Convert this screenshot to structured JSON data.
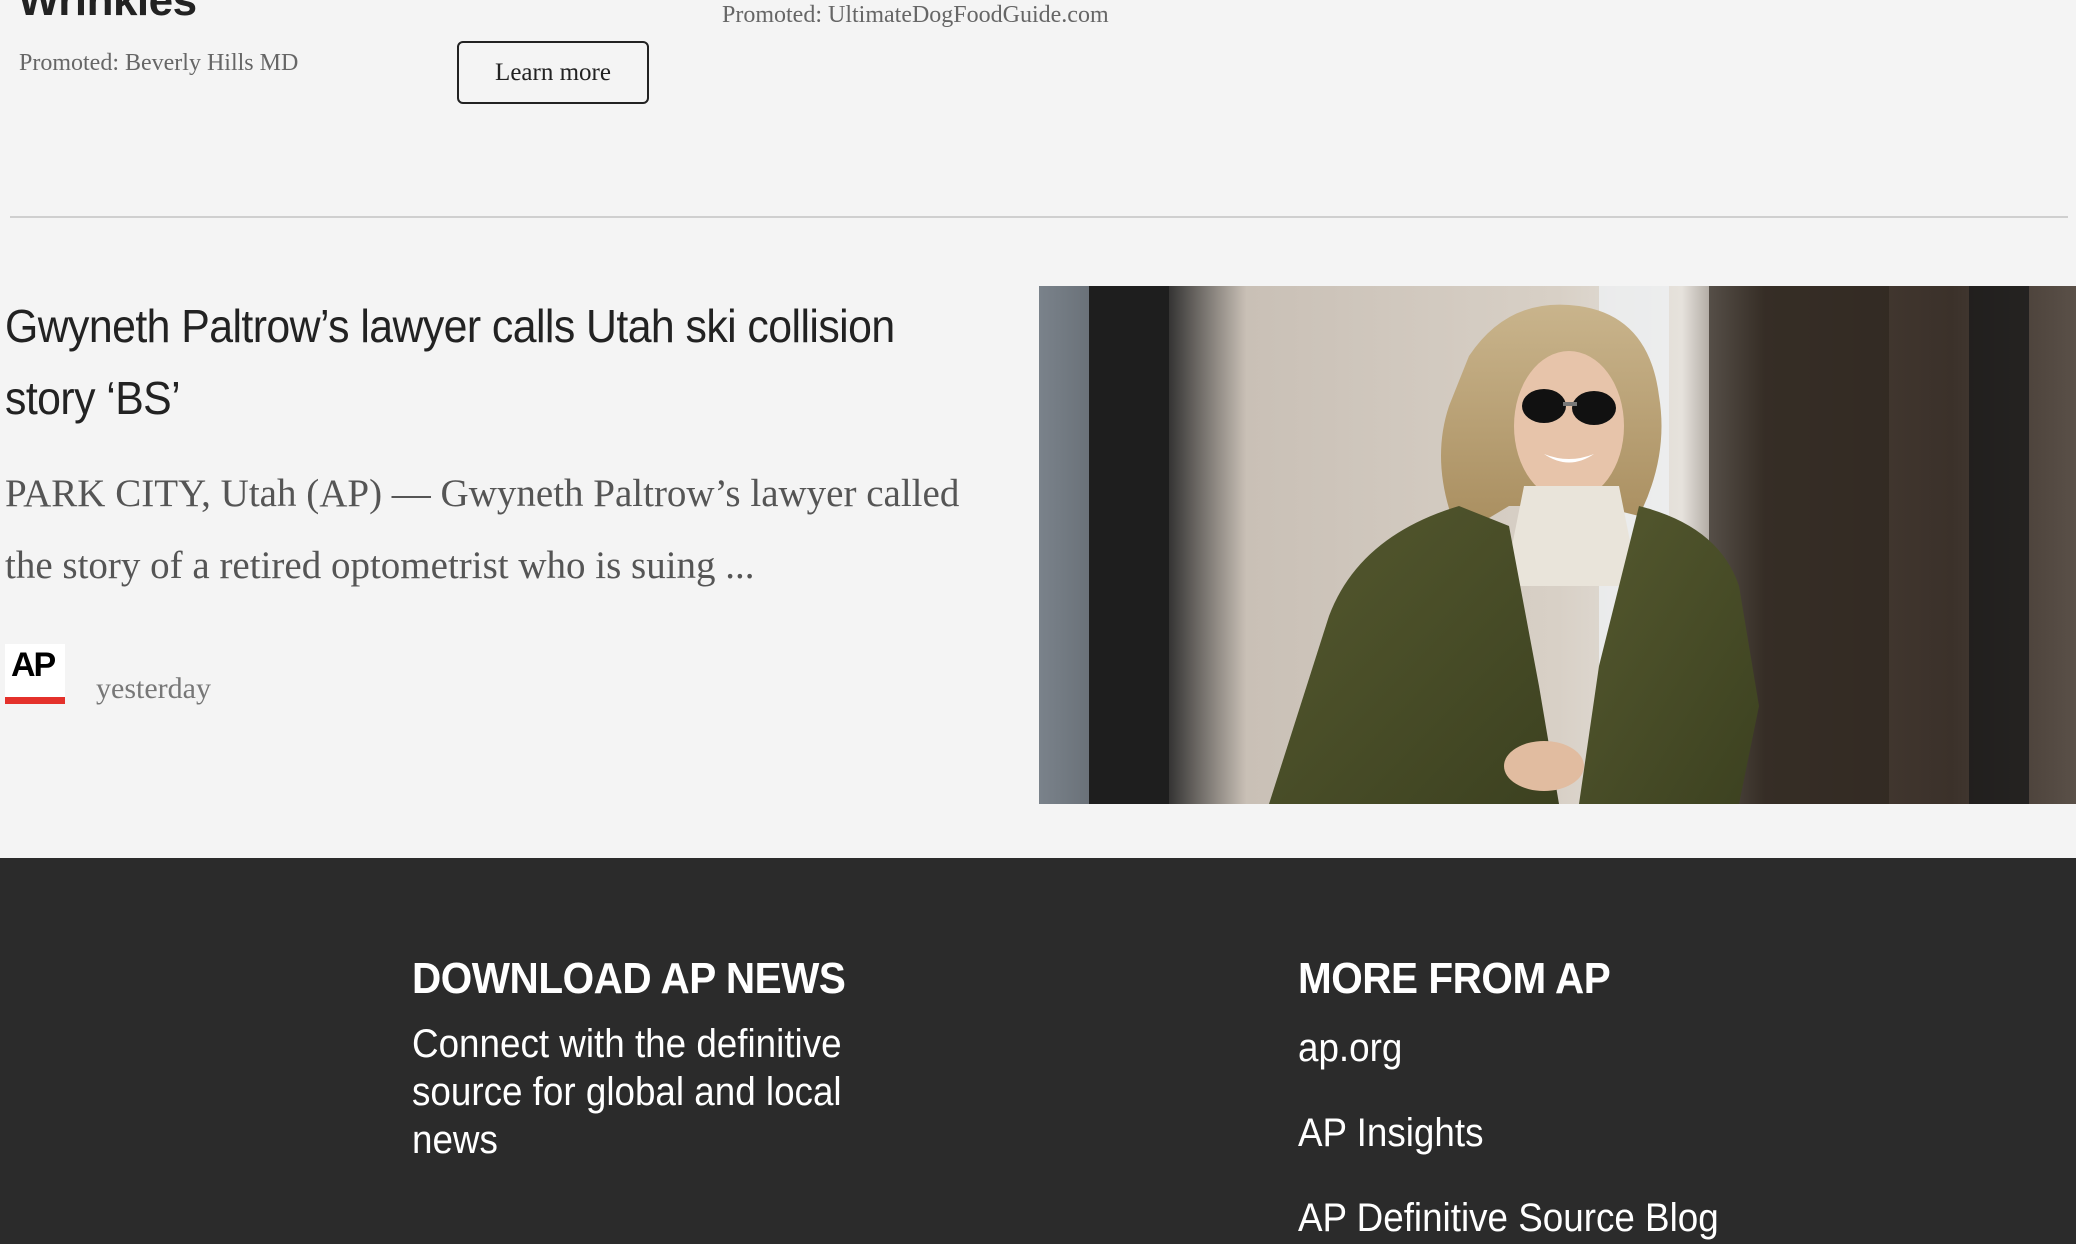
{
  "promos": {
    "left_title": "Wrinkles",
    "left_source": "Promoted: Beverly Hills MD",
    "learn_more_label": "Learn more",
    "right_source": "Promoted: UltimateDogFoodGuide.com"
  },
  "article": {
    "title": "Gwyneth Paltrow’s lawyer calls Utah ski collision story ‘BS’",
    "summary": "PARK CITY, Utah (AP) — Gwyneth Paltrow’s lawyer called the story of a retired optometrist who is suing ...",
    "publisher_logo_text": "AP",
    "timestamp": "yesterday",
    "image_icon": "news-photo"
  },
  "footer": {
    "download_heading": "DOWNLOAD AP NEWS",
    "download_text": "Connect with the definitive source for global and local news",
    "more_heading": "MORE FROM AP",
    "links": [
      "ap.org",
      "AP Insights",
      "AP Definitive Source Blog"
    ]
  },
  "colors": {
    "page_bg": "#f4f4f4",
    "footer_bg": "#2b2b2b",
    "ap_red": "#e4312b"
  }
}
